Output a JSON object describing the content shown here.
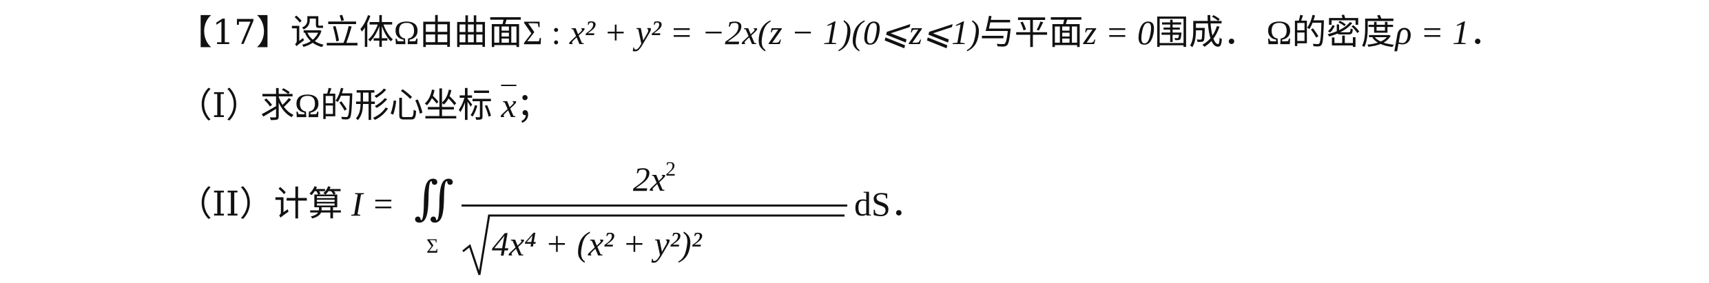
{
  "problem": {
    "number": "【17】",
    "stmt_a": "设立体",
    "omega": "Ω",
    "stmt_b": "由曲面",
    "sigma": "Σ",
    "colon": " : ",
    "eq_lhs": "x² + y² = −2x(z − 1)",
    "range": "(0⩽z⩽1)",
    "stmt_c": "与平面",
    "plane_eq": "z = 0",
    "stmt_d": "围成．",
    "stmt_e": "的密度",
    "rho_eq": "ρ = 1",
    "end": "．"
  },
  "part1": {
    "label": "（I）",
    "text": "求",
    "omega": "Ω",
    "text2": "的形心坐标",
    "xbar": "x",
    "end": "；"
  },
  "part2": {
    "label": "（II）",
    "text": "计算",
    "I_eq": "I =",
    "int_sign": "∬",
    "int_sub": "Σ",
    "numerator": "2x",
    "numerator_sup": "2",
    "denominator": "4x⁴ + (x² + y²)²",
    "dS": "dS",
    "end": "．"
  }
}
